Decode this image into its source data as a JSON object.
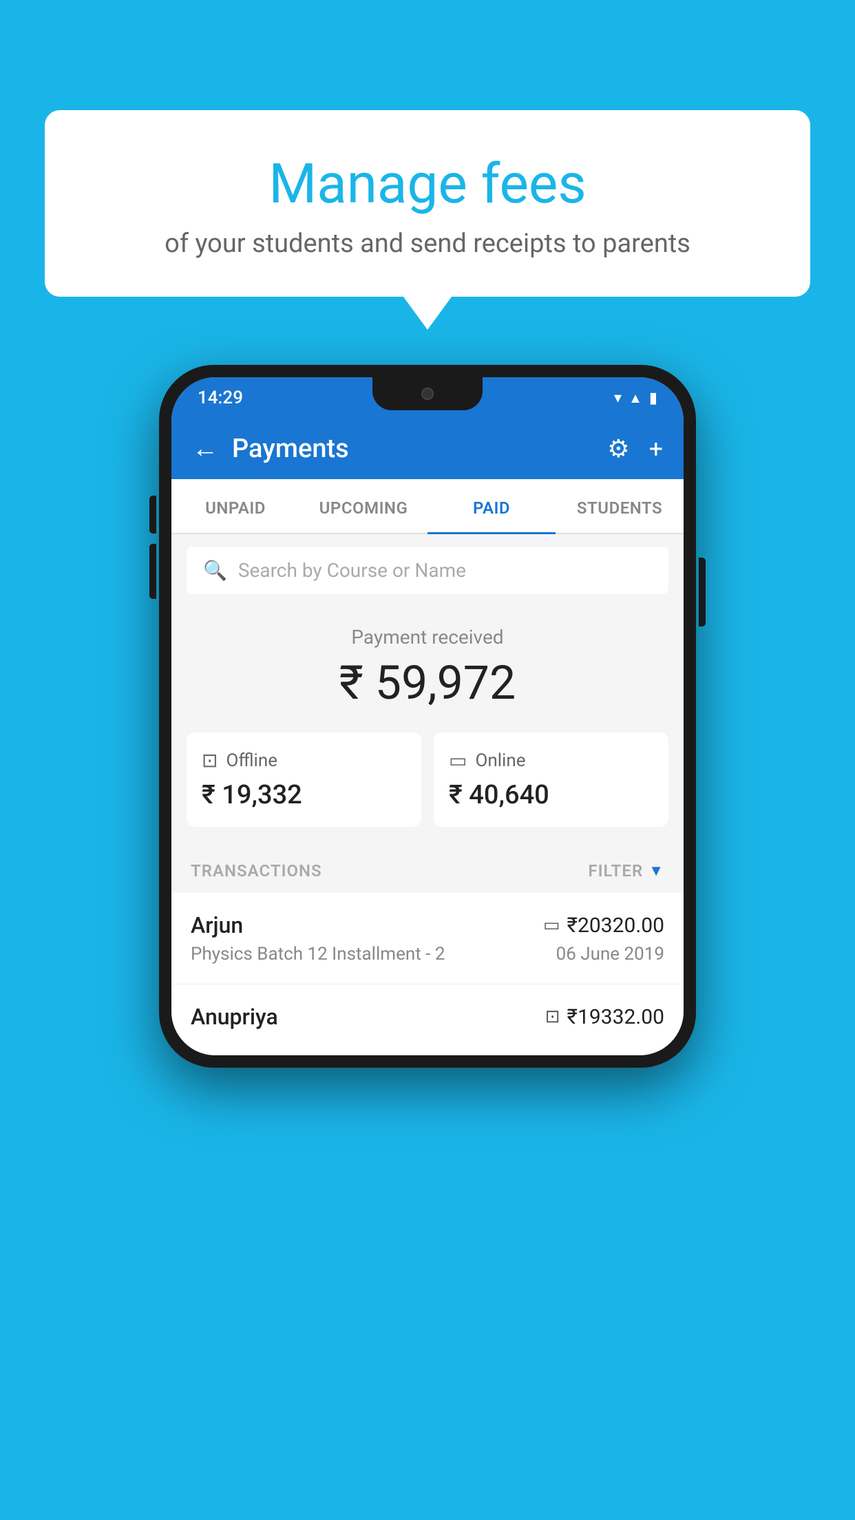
{
  "background_color": "#1ab5e8",
  "speech_bubble": {
    "title": "Manage fees",
    "subtitle": "of your students and send receipts to parents"
  },
  "phone": {
    "status_bar": {
      "time": "14:29",
      "icons": [
        "wifi",
        "signal",
        "battery"
      ]
    },
    "app_bar": {
      "title": "Payments",
      "back_icon": "←",
      "settings_icon": "⚙",
      "add_icon": "+"
    },
    "tabs": [
      {
        "label": "UNPAID",
        "active": false
      },
      {
        "label": "UPCOMING",
        "active": false
      },
      {
        "label": "PAID",
        "active": true
      },
      {
        "label": "STUDENTS",
        "active": false
      }
    ],
    "search": {
      "placeholder": "Search by Course or Name"
    },
    "payment_summary": {
      "label": "Payment received",
      "amount": "₹ 59,972",
      "offline": {
        "label": "Offline",
        "amount": "₹ 19,332"
      },
      "online": {
        "label": "Online",
        "amount": "₹ 40,640"
      }
    },
    "transactions": {
      "header_label": "TRANSACTIONS",
      "filter_label": "FILTER",
      "items": [
        {
          "name": "Arjun",
          "amount": "₹20320.00",
          "description": "Physics Batch 12 Installment - 2",
          "date": "06 June 2019",
          "payment_type": "online"
        },
        {
          "name": "Anupriya",
          "amount": "₹19332.00",
          "description": "",
          "date": "",
          "payment_type": "offline"
        }
      ]
    }
  }
}
